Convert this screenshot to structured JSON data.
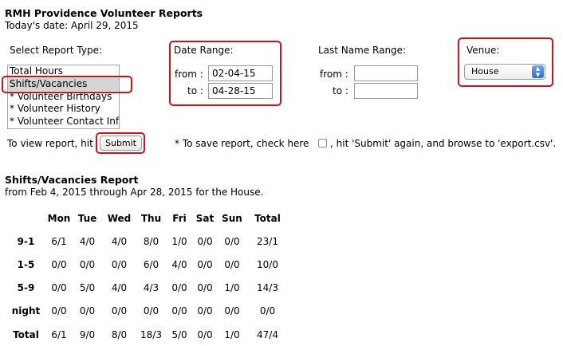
{
  "header": {
    "title": "RMH Providence Volunteer Reports",
    "today": "Today's date: April 29, 2015"
  },
  "report_type": {
    "label": "Select Report Type:",
    "options": [
      "Total Hours",
      "Shifts/Vacancies",
      "* Volunteer Birthdays",
      "* Volunteer History",
      "* Volunteer Contact Info"
    ],
    "selected": "Shifts/Vacancies"
  },
  "date_range": {
    "label": "Date Range:",
    "from_label": "from :",
    "to_label": "to :",
    "from_value": "02-04-15",
    "to_value": "04-28-15"
  },
  "last_name_range": {
    "label": "Last Name Range:",
    "from_label": "from :",
    "to_label": "to :",
    "from_value": "",
    "to_value": ""
  },
  "venue": {
    "label": "Venue:",
    "value": "House"
  },
  "actions": {
    "view_text": "To view report, hit",
    "submit_label": "Submit",
    "save_text_before": "* To save report, check here",
    "save_text_after": ", hit 'Submit' again, and browse to 'export.csv'."
  },
  "report": {
    "title": "Shifts/Vacancies Report",
    "subtitle": "from Feb 4, 2015 through Apr 28, 2015 for the House.",
    "columns": [
      "",
      "Mon",
      "Tue",
      "Wed",
      "Thu",
      "Fri",
      "Sat",
      "Sun",
      "Total"
    ],
    "rows": [
      [
        "9-1",
        "6/1",
        "4/0",
        "4/0",
        "8/0",
        "1/0",
        "0/0",
        "0/0",
        "23/1"
      ],
      [
        "1-5",
        "0/0",
        "0/0",
        "0/0",
        "6/0",
        "4/0",
        "0/0",
        "0/0",
        "10/0"
      ],
      [
        "5-9",
        "0/0",
        "5/0",
        "4/0",
        "4/3",
        "0/0",
        "0/0",
        "1/0",
        "14/3"
      ],
      [
        "night",
        "0/0",
        "0/0",
        "0/0",
        "0/0",
        "0/0",
        "0/0",
        "0/0",
        "0/0"
      ],
      [
        "Total",
        "6/1",
        "9/0",
        "8/0",
        "18/3",
        "5/0",
        "0/0",
        "1/0",
        "47/4"
      ]
    ]
  }
}
